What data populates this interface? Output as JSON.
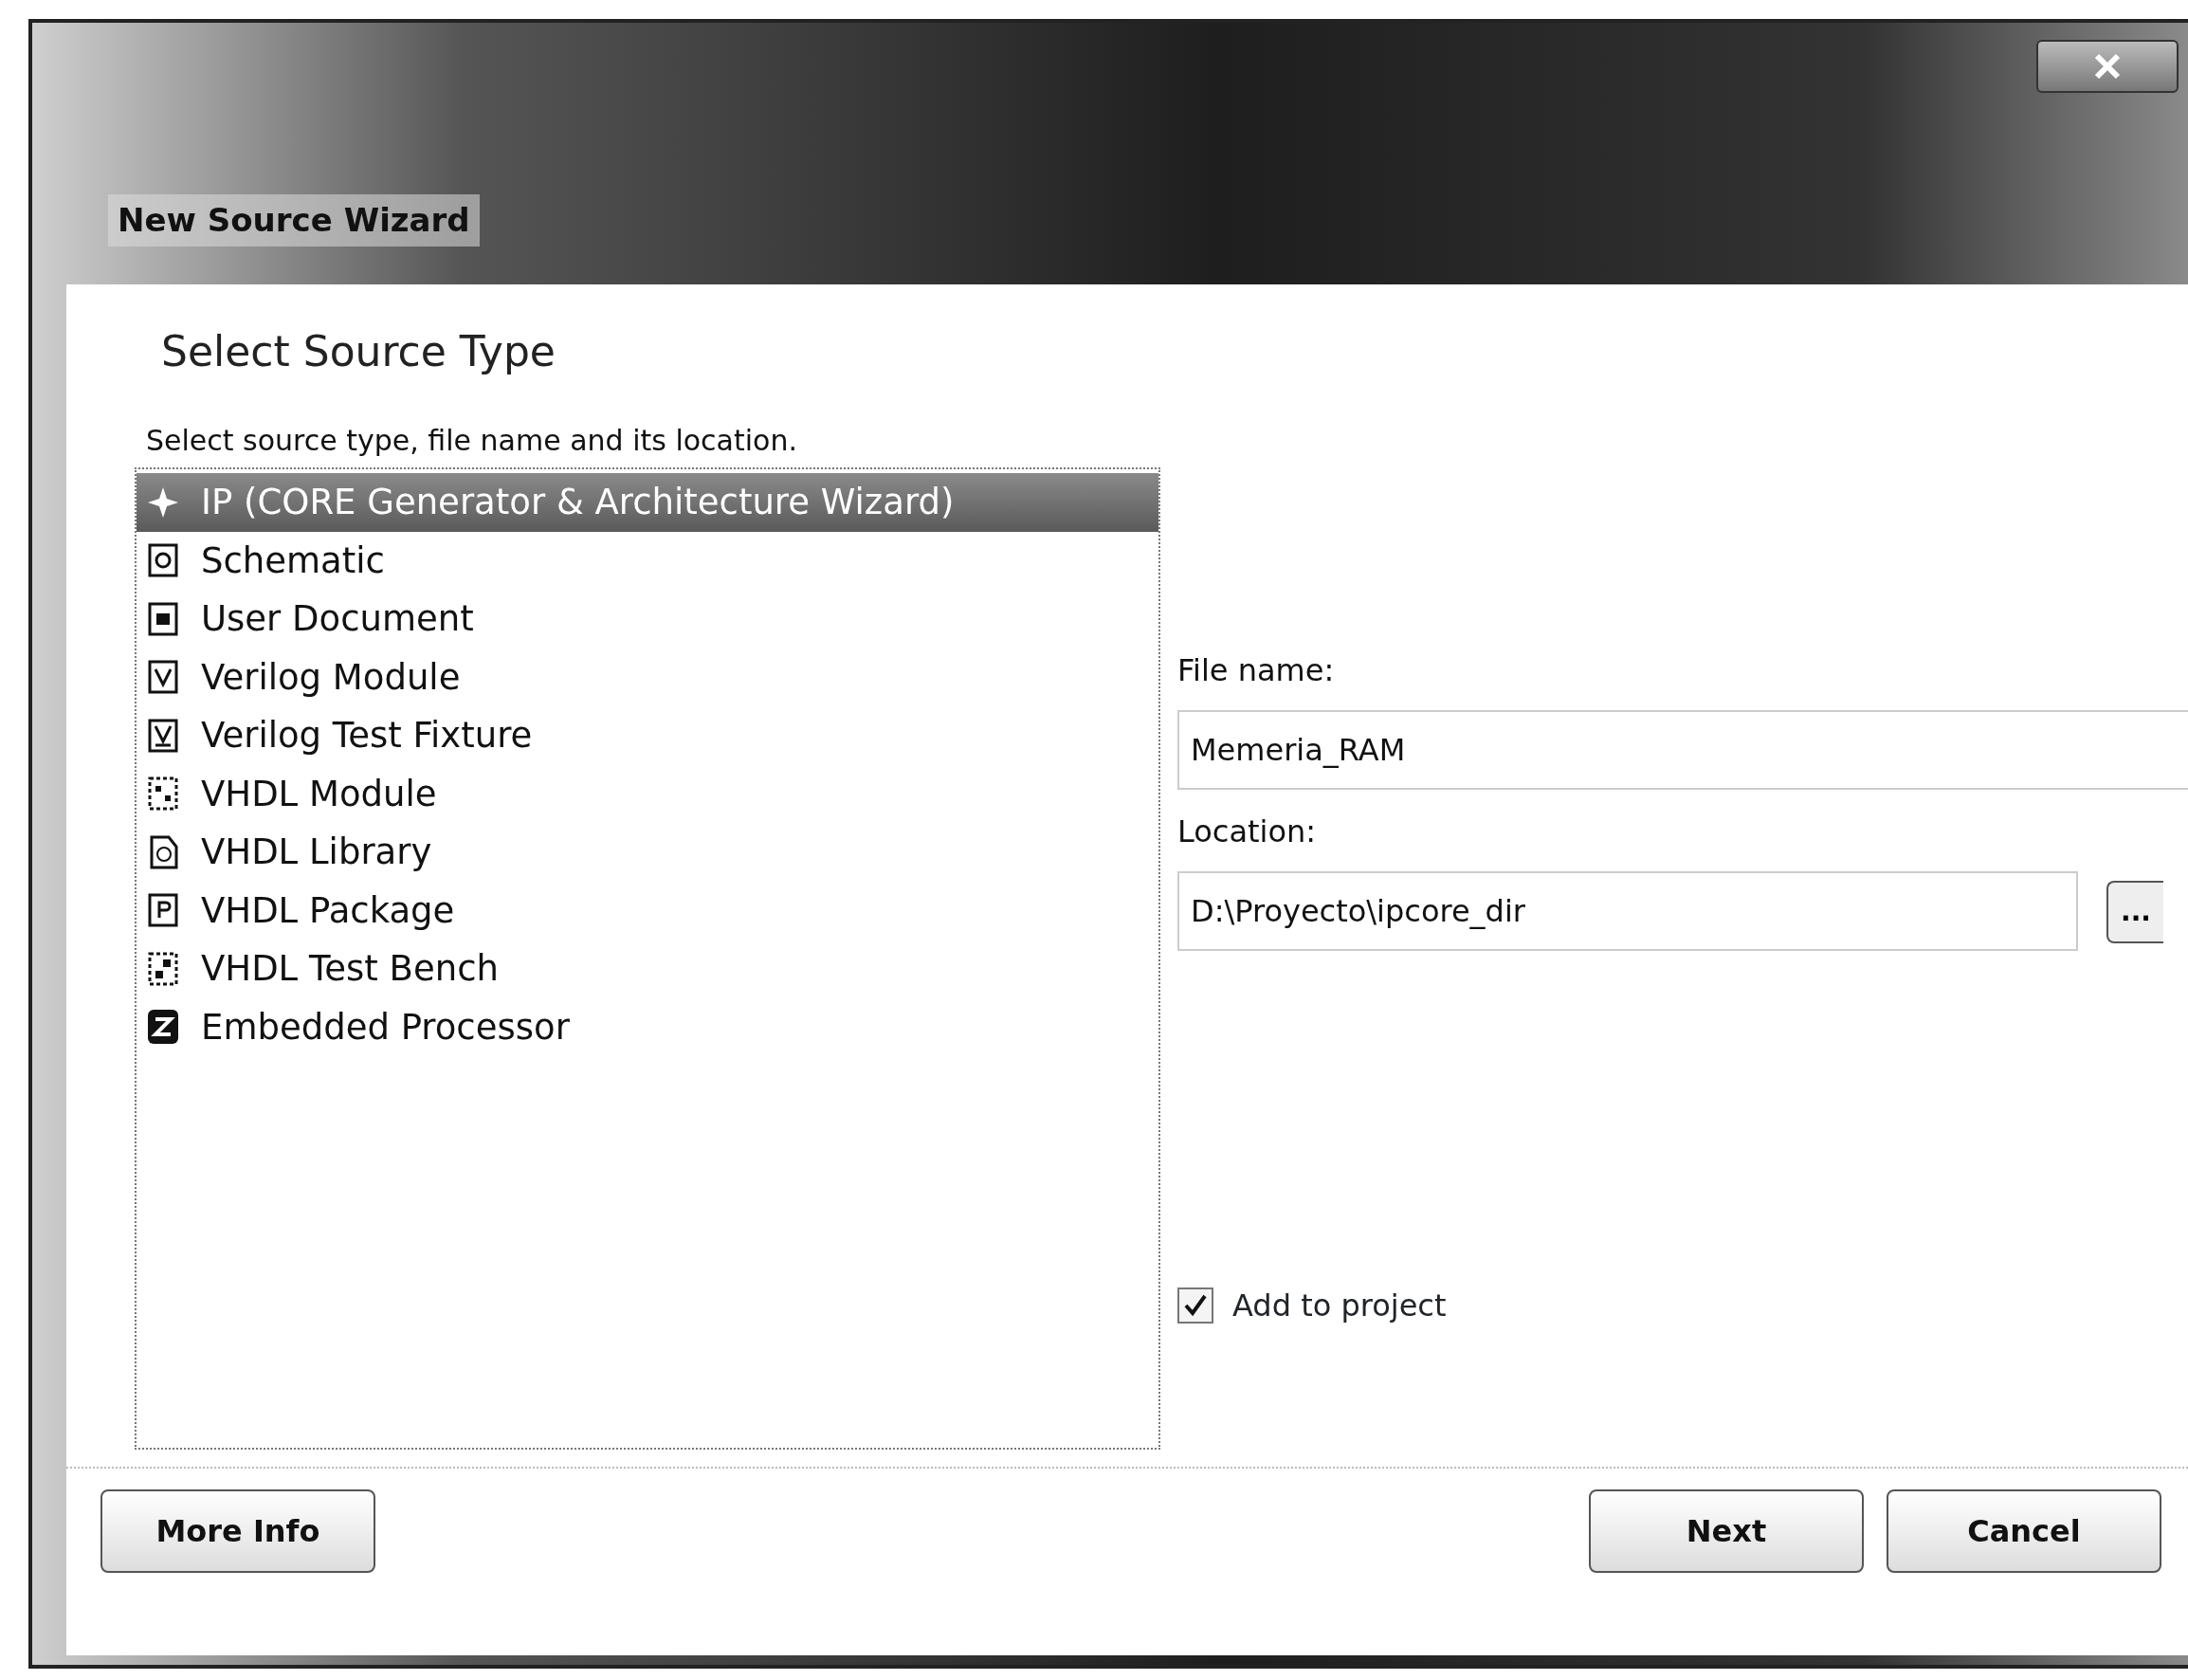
{
  "window": {
    "title": "New Source Wizard"
  },
  "heading": "Select Source Type",
  "instruction": "Select source type, file name and its location.",
  "source_types": [
    {
      "label": "IP (CORE Generator & Architecture Wizard)",
      "selected": true
    },
    {
      "label": "Schematic",
      "selected": false
    },
    {
      "label": "User Document",
      "selected": false
    },
    {
      "label": "Verilog Module",
      "selected": false
    },
    {
      "label": "Verilog Test Fixture",
      "selected": false
    },
    {
      "label": "VHDL Module",
      "selected": false
    },
    {
      "label": "VHDL Library",
      "selected": false
    },
    {
      "label": "VHDL Package",
      "selected": false
    },
    {
      "label": "VHDL Test Bench",
      "selected": false
    },
    {
      "label": "Embedded Processor",
      "selected": false
    }
  ],
  "file_name": {
    "label": "File name:",
    "value": "Memeria_RAM"
  },
  "location": {
    "label": "Location:",
    "value": "D:\\Proyecto\\ipcore_dir",
    "browse": "..."
  },
  "add_to_project": {
    "label": "Add to project",
    "checked": true
  },
  "buttons": {
    "more_info": "More Info",
    "next": "Next",
    "cancel": "Cancel"
  }
}
